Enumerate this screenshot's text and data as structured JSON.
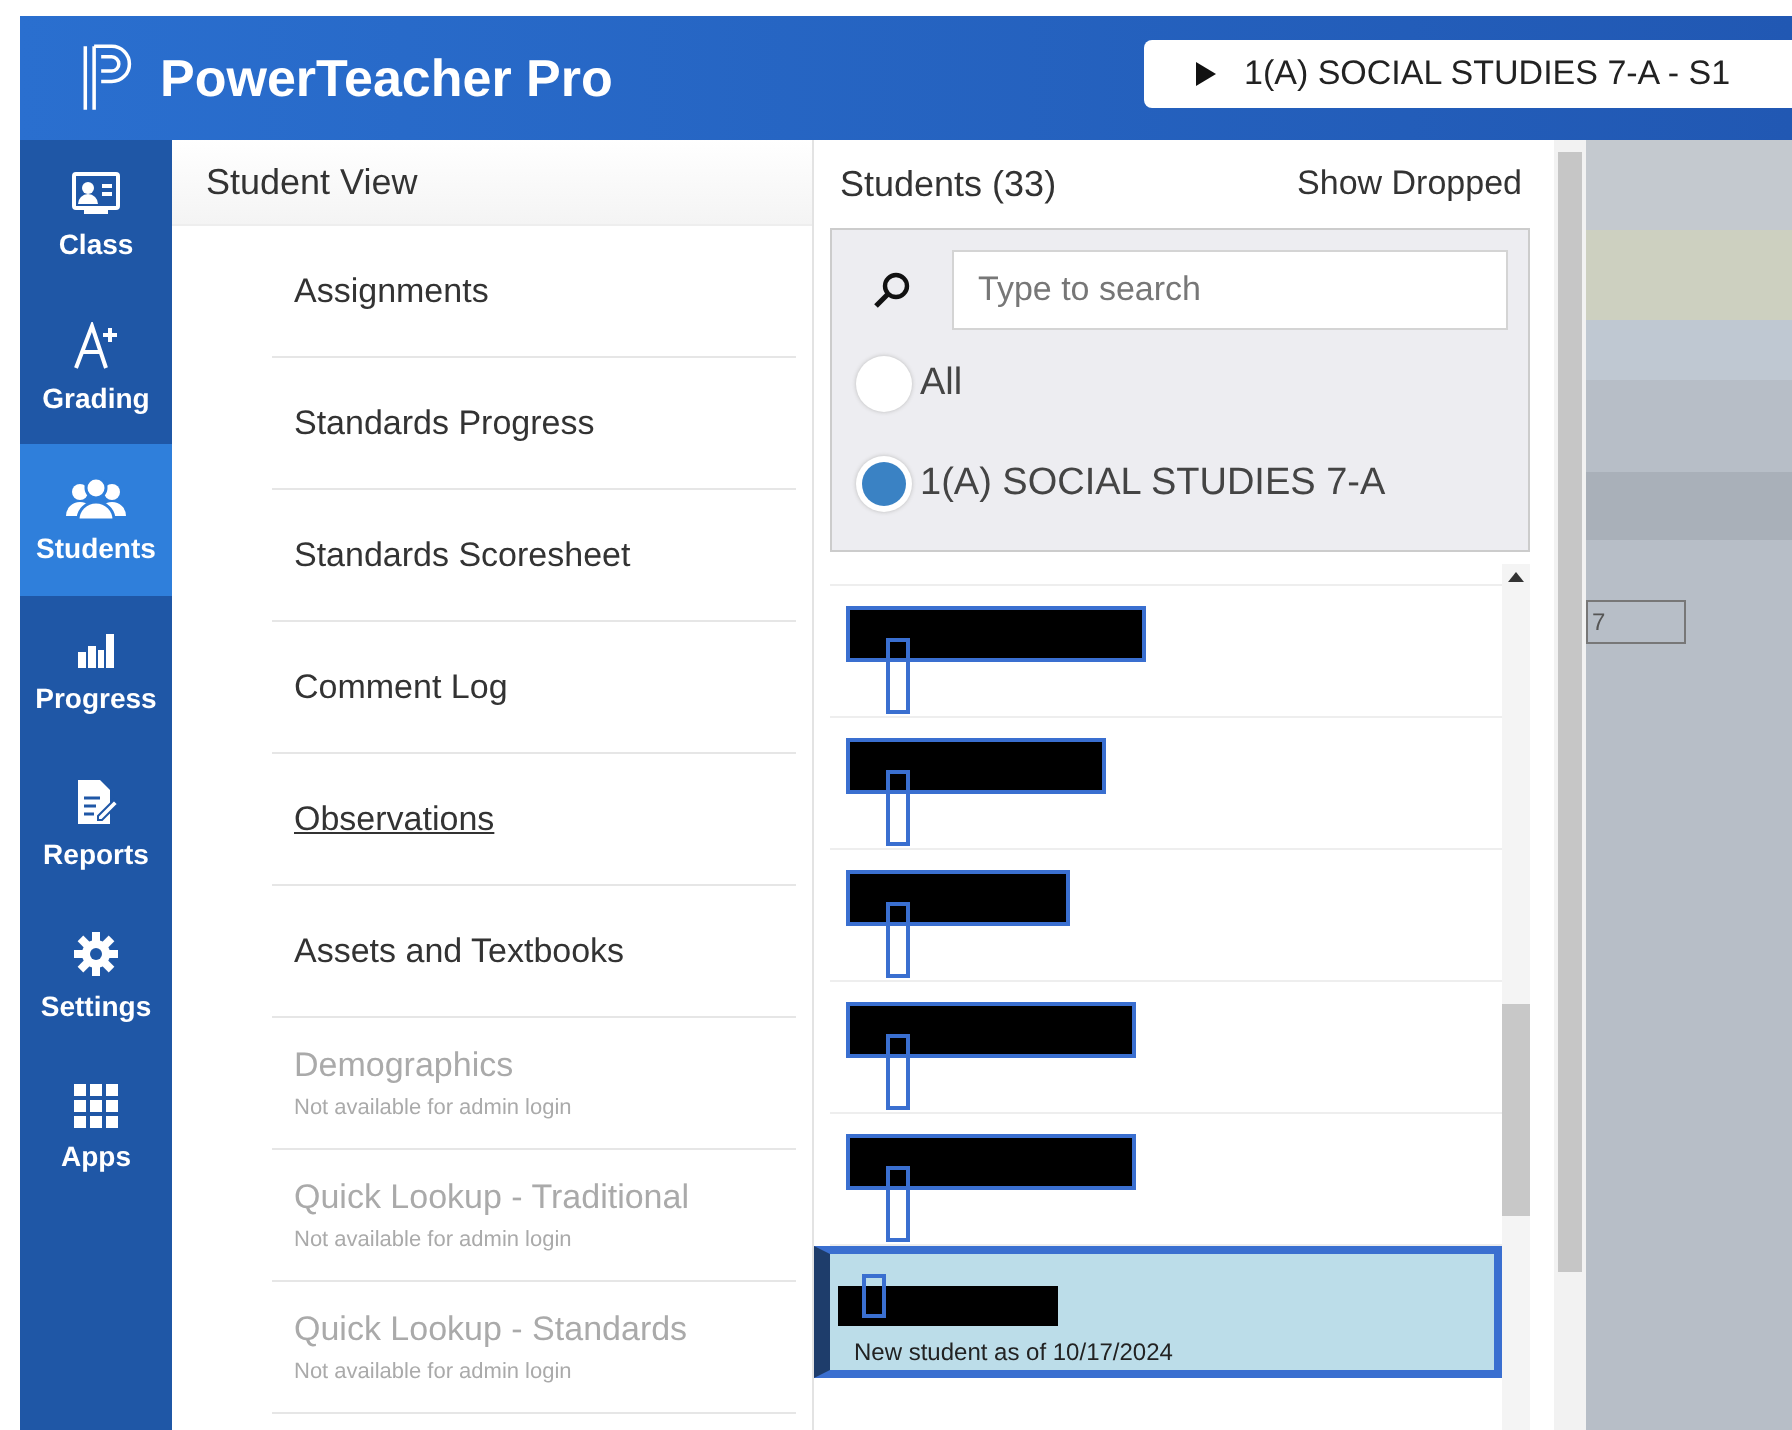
{
  "header": {
    "app_name": "PowerTeacher Pro",
    "course_selector": "1(A) SOCIAL STUDIES 7-A - S1"
  },
  "nav": [
    {
      "label": "Class",
      "selected": false
    },
    {
      "label": "Grading",
      "selected": false
    },
    {
      "label": "Students",
      "selected": true
    },
    {
      "label": "Progress",
      "selected": false
    },
    {
      "label": "Reports",
      "selected": false
    },
    {
      "label": "Settings",
      "selected": false
    },
    {
      "label": "Apps",
      "selected": false
    }
  ],
  "student_view": {
    "title": "Student View",
    "items": [
      {
        "label": "Assignments",
        "disabled": false,
        "underlined": false
      },
      {
        "label": "Standards Progress",
        "disabled": false,
        "underlined": false
      },
      {
        "label": "Standards Scoresheet",
        "disabled": false,
        "underlined": false
      },
      {
        "label": "Comment Log",
        "disabled": false,
        "underlined": false
      },
      {
        "label": "Observations",
        "disabled": false,
        "underlined": true
      },
      {
        "label": "Assets and Textbooks",
        "disabled": false,
        "underlined": false
      },
      {
        "label": "Demographics",
        "disabled": true,
        "underlined": false,
        "note": "Not available for admin login"
      },
      {
        "label": "Quick Lookup - Traditional",
        "disabled": true,
        "underlined": false,
        "note": "Not available for admin login"
      },
      {
        "label": "Quick Lookup - Standards",
        "disabled": true,
        "underlined": false,
        "note": "Not available for admin login"
      }
    ]
  },
  "students": {
    "title": "Students (33)",
    "show_dropped": "Show Dropped",
    "search": {
      "placeholder": "Type to search"
    },
    "filters": [
      {
        "label": "All",
        "selected": false
      },
      {
        "label": "1(A) SOCIAL STUDIES 7-A",
        "selected": true
      }
    ],
    "rows": [
      {
        "selected": false
      },
      {
        "selected": false
      },
      {
        "selected": false
      },
      {
        "selected": false
      },
      {
        "selected": false
      },
      {
        "selected": true,
        "note": "New student as of 10/17/2024"
      }
    ]
  },
  "background": {
    "field_value": "7"
  }
}
